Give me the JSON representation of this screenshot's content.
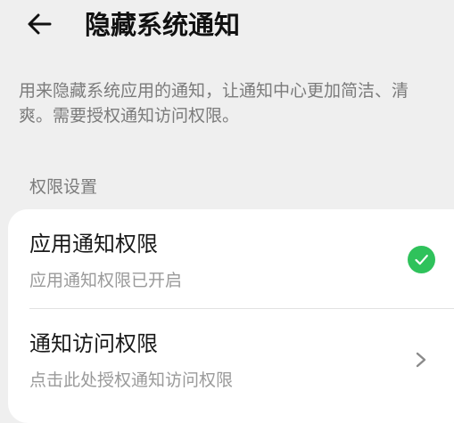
{
  "header": {
    "back_icon": "arrow-left-icon",
    "title": "隐藏系统通知"
  },
  "description": "用来隐藏系统应用的通知，让通知中心更加简洁、清爽。需要授权通知访问权限。",
  "section": {
    "label": "权限设置"
  },
  "settings": {
    "items": [
      {
        "title": "应用通知权限",
        "subtitle": "应用通知权限已开启",
        "icon": "check-circle-icon",
        "status_color": "#2fc25b"
      },
      {
        "title": "通知访问权限",
        "subtitle": "点击此处授权通知访问权限",
        "icon": "chevron-right-icon"
      }
    ]
  }
}
